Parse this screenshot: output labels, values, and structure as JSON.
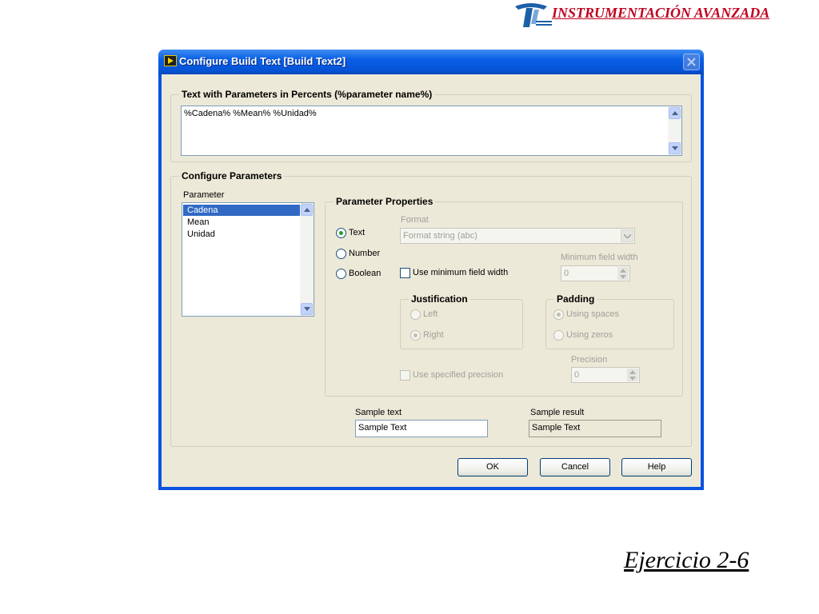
{
  "slide": {
    "brand_text": "INSTRUMENTACIÓN AVANZADA",
    "exercise_label": "Ejercicio 2-6",
    "colors": {
      "brand": "#c0001f",
      "window_blue": "#0a52e0"
    }
  },
  "window": {
    "title": "Configure Build Text [Build Text2]",
    "icon": "labview-vi-icon"
  },
  "text_group": {
    "title": "Text with Parameters in Percents (%parameter name%)",
    "value": "%Cadena% %Mean% %Unidad%"
  },
  "params_group": {
    "title": "Configure Parameters",
    "list_label": "Parameter",
    "items": [
      "Cadena",
      "Mean",
      "Unidad"
    ],
    "selected": "Cadena"
  },
  "properties": {
    "title": "Parameter Properties",
    "type_options": [
      "Text",
      "Number",
      "Boolean"
    ],
    "type_selected": "Text",
    "format_label": "Format",
    "format_value": "Format string  (abc)",
    "min_width_check_label": "Use minimum field width",
    "min_width_label": "Minimum field width",
    "min_width_value": "0",
    "justification": {
      "title": "Justification",
      "options": [
        "Left",
        "Right"
      ],
      "selected": "Right"
    },
    "padding": {
      "title": "Padding",
      "options": [
        "Using spaces",
        "Using zeros"
      ],
      "selected": "Using spaces"
    },
    "precision_check_label": "Use specified precision",
    "precision_label": "Precision",
    "precision_value": "0"
  },
  "sample": {
    "text_label": "Sample text",
    "text_value": "Sample Text",
    "result_label": "Sample result",
    "result_value": "Sample Text"
  },
  "buttons": {
    "ok": "OK",
    "cancel": "Cancel",
    "help": "Help"
  }
}
